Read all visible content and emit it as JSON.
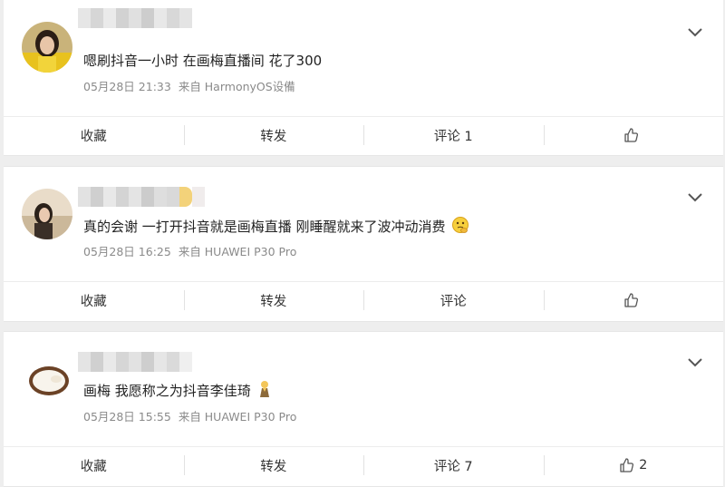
{
  "posts": [
    {
      "text": "嗯刷抖音一小时 在画梅直播间 花了300",
      "date": "05月28日 21:33",
      "source": "来自 HarmonyOS设備",
      "actions": {
        "favorite": "收藏",
        "repost": "转发",
        "comment": "评论 1",
        "like_count": ""
      }
    },
    {
      "text": "真的会谢 一打开抖音就是画梅直播 刚睡醒就来了波冲动消费",
      "date": "05月28日 16:25",
      "source": "来自 HUAWEI P30 Pro",
      "actions": {
        "favorite": "收藏",
        "repost": "转发",
        "comment": "评论",
        "like_count": ""
      }
    },
    {
      "text": "画梅 我愿称之为抖音李佳琦",
      "date": "05月28日 15:55",
      "source": "来自 HUAWEI P30 Pro",
      "actions": {
        "favorite": "收藏",
        "repost": "转发",
        "comment": "评论 7",
        "like_count": "2"
      }
    }
  ],
  "icons": {
    "chevron": "chevron-down-icon",
    "like": "thumbs-up-icon",
    "emoji_2": "thinking-emoji",
    "emoji_3": "praying-emoji"
  },
  "colors": {
    "background": "#eeeeee",
    "card": "#ffffff",
    "text": "#222222",
    "meta": "#8a8a8a"
  }
}
